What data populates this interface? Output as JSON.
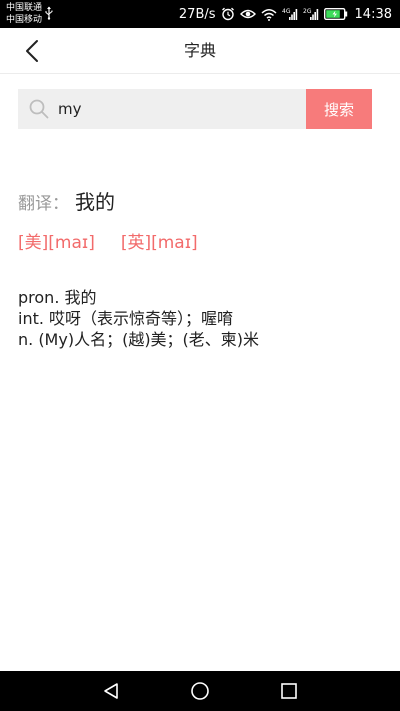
{
  "status_bar": {
    "carrier1": "中国联通",
    "carrier2": "中国移动",
    "net_speed": "27B/s",
    "signal1_label": "4G",
    "signal2_label": "2G",
    "time": "14:38",
    "battery_level": 0.8
  },
  "header": {
    "title": "字典"
  },
  "search": {
    "query": "my",
    "button_label": "搜索"
  },
  "result": {
    "translation_label": "翻译：",
    "translation": "我的",
    "pron_us": "[美][maɪ]",
    "pron_uk": "[英][maɪ]",
    "definitions": [
      "pron. 我的",
      "int. 哎呀（表示惊奇等）；喔唷",
      "n. (My)人名；(越)美；(老、柬)米"
    ]
  },
  "colors": {
    "accent": "#f77b7b",
    "pron_text": "#f26b6b",
    "search_bg": "#efefef",
    "label_gray": "#999999"
  }
}
